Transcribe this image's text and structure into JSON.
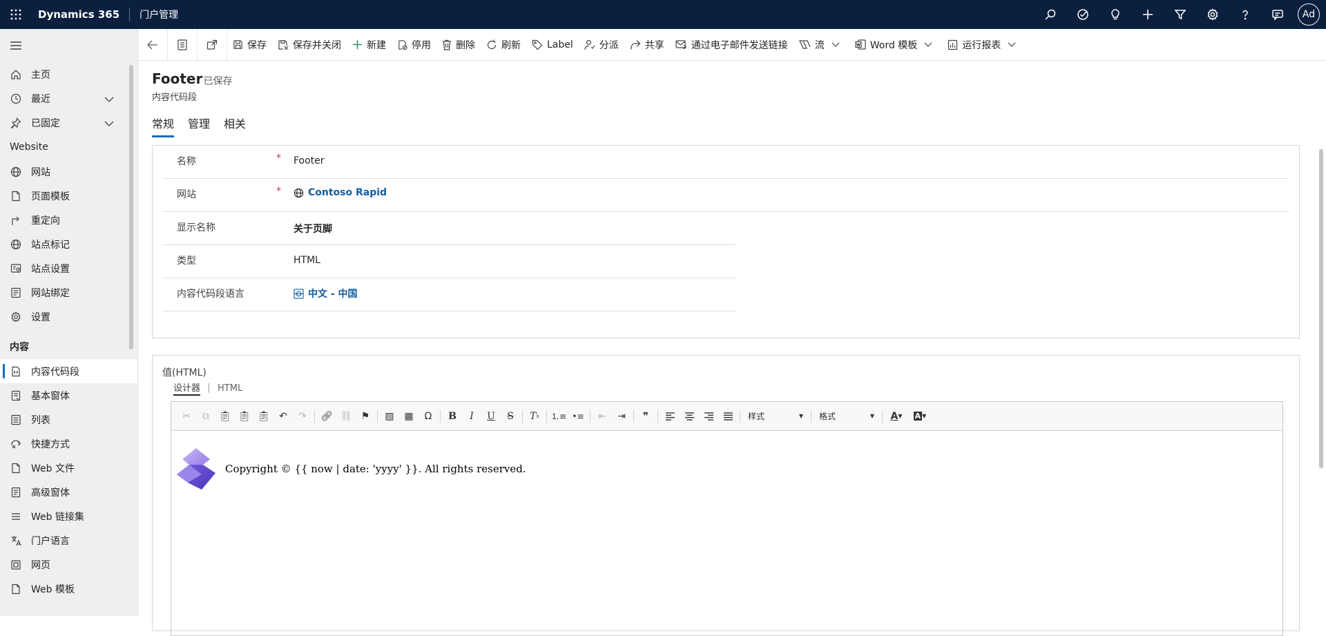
{
  "topbar": {
    "app_title": "Dynamics 365",
    "app_name": "门户管理",
    "avatar_initials": "Ad",
    "icons": [
      "search-icon",
      "task-check-icon",
      "lightbulb-icon",
      "plus-icon",
      "filter-icon",
      "settings-icon",
      "help-icon",
      "chat-icon"
    ]
  },
  "sidebar": {
    "items_top": [
      {
        "label": "主页",
        "icon": "home-icon"
      },
      {
        "label": "最近",
        "icon": "clock-icon",
        "expandable": true
      },
      {
        "label": "已固定",
        "icon": "pin-icon",
        "expandable": true
      }
    ],
    "section_website": "Website",
    "items_website": [
      {
        "label": "网站",
        "icon": "globe-icon"
      },
      {
        "label": "页面模板",
        "icon": "document-icon"
      },
      {
        "label": "重定向",
        "icon": "redirect-icon"
      },
      {
        "label": "站点标记",
        "icon": "globe-icon"
      },
      {
        "label": "站点设置",
        "icon": "site-settings-icon"
      },
      {
        "label": "网站绑定",
        "icon": "binding-icon"
      },
      {
        "label": "设置",
        "icon": "gear-icon"
      }
    ],
    "section_content": "内容",
    "items_content": [
      {
        "label": "内容代码段",
        "icon": "snippet-icon",
        "active": true
      },
      {
        "label": "基本窗体",
        "icon": "form-icon"
      },
      {
        "label": "列表",
        "icon": "list-icon"
      },
      {
        "label": "快捷方式",
        "icon": "shortcut-icon"
      },
      {
        "label": "Web 文件",
        "icon": "file-icon"
      },
      {
        "label": "高级窗体",
        "icon": "advanced-form-icon"
      },
      {
        "label": "Web 链接集",
        "icon": "link-set-icon"
      },
      {
        "label": "门户语言",
        "icon": "language-icon"
      },
      {
        "label": "网页",
        "icon": "webpage-icon"
      },
      {
        "label": "Web 模板",
        "icon": "template-icon"
      }
    ]
  },
  "commandbar": {
    "buttons": [
      {
        "label": "保存",
        "icon": "save-icon"
      },
      {
        "label": "保存并关闭",
        "icon": "save-close-icon"
      },
      {
        "label": "新建",
        "icon": "plus-icon"
      },
      {
        "label": "停用",
        "icon": "deactivate-icon"
      },
      {
        "label": "删除",
        "icon": "delete-icon"
      },
      {
        "label": "刷新",
        "icon": "refresh-icon"
      },
      {
        "label": "Label",
        "icon": "label-icon"
      },
      {
        "label": "分派",
        "icon": "assign-icon"
      },
      {
        "label": "共享",
        "icon": "share-icon"
      },
      {
        "label": "通过电子邮件发送链接",
        "icon": "email-link-icon"
      },
      {
        "label": "流",
        "icon": "flow-icon",
        "dropdown": true
      },
      {
        "label": "Word 模板",
        "icon": "word-icon",
        "dropdown": true
      },
      {
        "label": "运行报表",
        "icon": "report-icon",
        "dropdown": true
      }
    ]
  },
  "record": {
    "title": "Footer",
    "saved_status": "- 已保存",
    "entity": "内容代码段",
    "tabs": [
      "常规",
      "管理",
      "相关"
    ],
    "active_tab": "常规"
  },
  "fields": {
    "name": {
      "label": "名称",
      "value": "Footer",
      "required": "*"
    },
    "website": {
      "label": "网站",
      "value": "Contoso Rapid",
      "required": "*"
    },
    "display_name": {
      "label": "显示名称",
      "value": "关于页脚"
    },
    "type": {
      "label": "类型",
      "value": "HTML"
    },
    "language": {
      "label": "内容代码段语言",
      "value": "中文 - 中国"
    }
  },
  "value_section": {
    "label": "值(HTML)",
    "editor_tabs": [
      "设计器",
      "HTML"
    ],
    "style_select": "样式",
    "format_select": "格式",
    "content_text": "Copyright © {{ now | date: 'yyyy' }}. All rights reserved."
  }
}
